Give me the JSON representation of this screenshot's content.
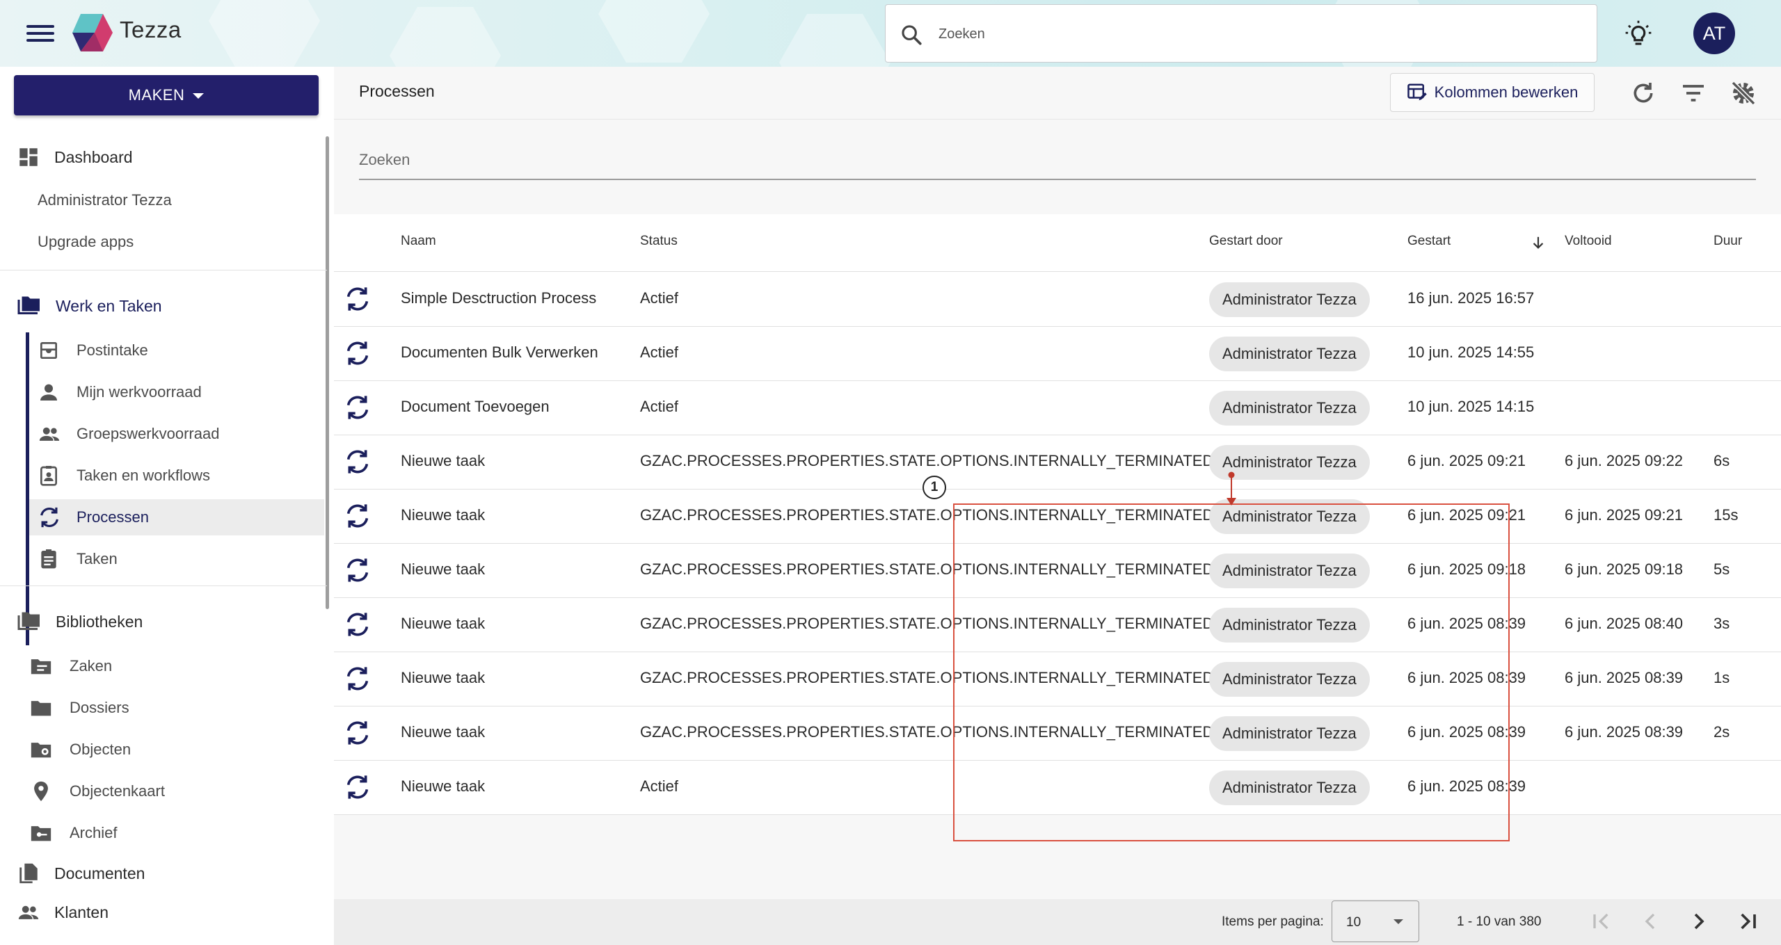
{
  "header": {
    "app_name": "Tezza",
    "search_placeholder": "Zoeken",
    "avatar_initials": "AT",
    "brand_color": "#1b1f5c"
  },
  "sidebar": {
    "create_button": "MAKEN",
    "dashboard": "Dashboard",
    "dashboard_items": [
      "Administrator Tezza",
      "Upgrade apps"
    ],
    "work_section": "Werk en Taken",
    "work_items": [
      {
        "label": "Postintake",
        "icon": "inbox-icon"
      },
      {
        "label": "Mijn werkvoorraad",
        "icon": "person-icon"
      },
      {
        "label": "Groepswerkvoorraad",
        "icon": "group-icon"
      },
      {
        "label": "Taken en workflows",
        "icon": "clipboard-person-icon"
      },
      {
        "label": "Processen",
        "icon": "sync-icon",
        "active": true
      },
      {
        "label": "Taken",
        "icon": "clipboard-icon"
      }
    ],
    "library_section": "Bibliotheken",
    "library_items": [
      {
        "label": "Zaken",
        "icon": "folder-lines-icon"
      },
      {
        "label": "Dossiers",
        "icon": "folder-icon"
      },
      {
        "label": "Objecten",
        "icon": "folder-pin-icon"
      },
      {
        "label": "Objectenkaart",
        "icon": "map-pin-icon"
      },
      {
        "label": "Archief",
        "icon": "folder-key-icon"
      }
    ],
    "documents": "Documenten",
    "clients": "Klanten"
  },
  "main": {
    "title": "Processen",
    "edit_columns_button": "Kolommen bewerken",
    "filter_placeholder": "Zoeken",
    "columns": {
      "name": "Naam",
      "status": "Status",
      "started_by": "Gestart door",
      "started": "Gestart",
      "completed": "Voltooid",
      "duration": "Duur"
    },
    "rows": [
      {
        "name": "Simple Desctruction Process",
        "status": "Actief",
        "started_by": "Administrator Tezza",
        "started": "16 jun. 2025 16:57",
        "completed": "",
        "duration": ""
      },
      {
        "name": "Documenten Bulk Verwerken",
        "status": "Actief",
        "started_by": "Administrator Tezza",
        "started": "10 jun. 2025 14:55",
        "completed": "",
        "duration": ""
      },
      {
        "name": "Document Toevoegen",
        "status": "Actief",
        "started_by": "Administrator Tezza",
        "started": "10 jun. 2025 14:15",
        "completed": "",
        "duration": ""
      },
      {
        "name": "Nieuwe taak",
        "status": "GZAC.PROCESSES.PROPERTIES.STATE.OPTIONS.INTERNALLY_TERMINATED",
        "started_by": "Administrator Tezza",
        "started": "6 jun. 2025 09:21",
        "completed": "6 jun. 2025 09:22",
        "duration": "6s"
      },
      {
        "name": "Nieuwe taak",
        "status": "GZAC.PROCESSES.PROPERTIES.STATE.OPTIONS.INTERNALLY_TERMINATED",
        "started_by": "Administrator Tezza",
        "started": "6 jun. 2025 09:21",
        "completed": "6 jun. 2025 09:21",
        "duration": "15s"
      },
      {
        "name": "Nieuwe taak",
        "status": "GZAC.PROCESSES.PROPERTIES.STATE.OPTIONS.INTERNALLY_TERMINATED",
        "started_by": "Administrator Tezza",
        "started": "6 jun. 2025 09:18",
        "completed": "6 jun. 2025 09:18",
        "duration": "5s"
      },
      {
        "name": "Nieuwe taak",
        "status": "GZAC.PROCESSES.PROPERTIES.STATE.OPTIONS.INTERNALLY_TERMINATED",
        "started_by": "Administrator Tezza",
        "started": "6 jun. 2025 08:39",
        "completed": "6 jun. 2025 08:40",
        "duration": "3s"
      },
      {
        "name": "Nieuwe taak",
        "status": "GZAC.PROCESSES.PROPERTIES.STATE.OPTIONS.INTERNALLY_TERMINATED",
        "started_by": "Administrator Tezza",
        "started": "6 jun. 2025 08:39",
        "completed": "6 jun. 2025 08:39",
        "duration": "1s"
      },
      {
        "name": "Nieuwe taak",
        "status": "GZAC.PROCESSES.PROPERTIES.STATE.OPTIONS.INTERNALLY_TERMINATED",
        "started_by": "Administrator Tezza",
        "started": "6 jun. 2025 08:39",
        "completed": "6 jun. 2025 08:39",
        "duration": "2s"
      },
      {
        "name": "Nieuwe taak",
        "status": "Actief",
        "started_by": "Administrator Tezza",
        "started": "6 jun. 2025 08:39",
        "completed": "",
        "duration": ""
      }
    ]
  },
  "annotation": {
    "badge": "1",
    "color": "#d9503f"
  },
  "paginator": {
    "items_per_page_label": "Items per pagina:",
    "items_per_page_value": "10",
    "range": "1 - 10 van 380"
  }
}
